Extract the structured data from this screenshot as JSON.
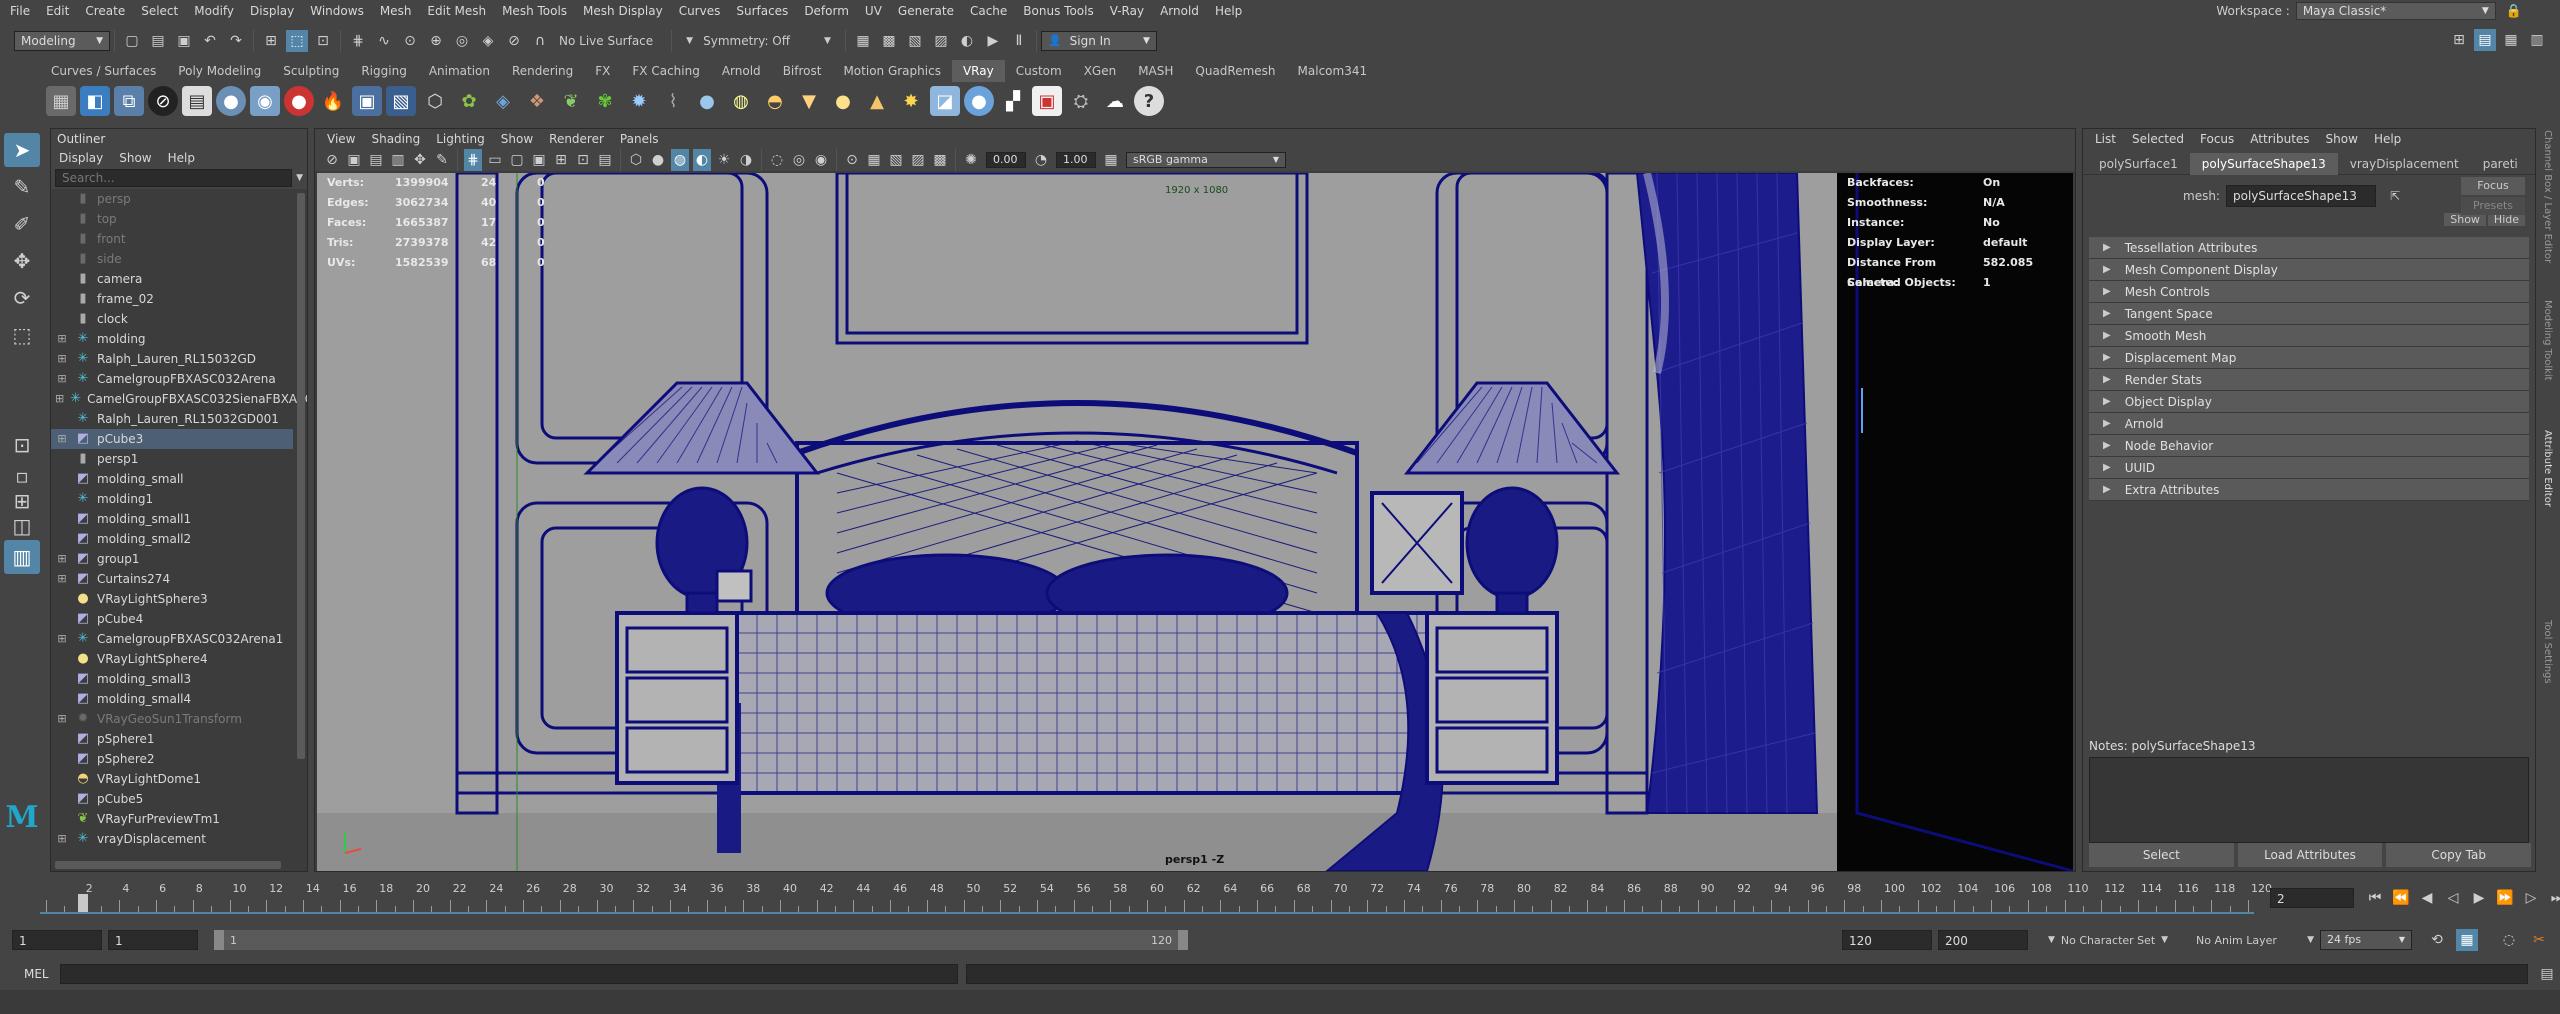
{
  "menu": [
    "File",
    "Edit",
    "Create",
    "Select",
    "Modify",
    "Display",
    "Windows",
    "Mesh",
    "Edit Mesh",
    "Mesh Tools",
    "Mesh Display",
    "Curves",
    "Surfaces",
    "Deform",
    "UV",
    "Generate",
    "Cache",
    "Bonus Tools",
    "V-Ray",
    "Arnold",
    "Help"
  ],
  "workspace": {
    "label": "Workspace :",
    "value": "Maya Classic*"
  },
  "statusline": {
    "mode": "Modeling",
    "live_surface": "No Live Surface",
    "symmetry": "Symmetry: Off",
    "sign_in": "Sign In"
  },
  "shelf_tabs": [
    "Curves / Surfaces",
    "Poly Modeling",
    "Sculpting",
    "Rigging",
    "Animation",
    "Rendering",
    "FX",
    "FX Caching",
    "Arnold",
    "Bifrost",
    "Motion Graphics",
    "VRay",
    "Custom",
    "XGen",
    "MASH",
    "QuadRemesh",
    "Malcom341"
  ],
  "shelf_active": "VRay",
  "outliner": {
    "title": "Outliner",
    "menu": [
      "Display",
      "Show",
      "Help"
    ],
    "search_placeholder": "Search...",
    "items": [
      {
        "name": "persp",
        "icon": "camera",
        "dim": true,
        "expand": false
      },
      {
        "name": "top",
        "icon": "camera",
        "dim": true,
        "expand": false
      },
      {
        "name": "front",
        "icon": "camera",
        "dim": true,
        "expand": false
      },
      {
        "name": "side",
        "icon": "camera",
        "dim": true,
        "expand": false
      },
      {
        "name": "camera",
        "icon": "camera",
        "dim": false,
        "expand": false
      },
      {
        "name": "frame_02",
        "icon": "camera",
        "dim": false,
        "expand": false
      },
      {
        "name": "clock",
        "icon": "camera",
        "dim": false,
        "expand": false
      },
      {
        "name": "molding",
        "icon": "group",
        "dim": false,
        "expand": true
      },
      {
        "name": "Ralph_Lauren_RL15032GD",
        "icon": "group",
        "dim": false,
        "expand": true
      },
      {
        "name": "CamelgroupFBXASC032Arena",
        "icon": "group",
        "dim": false,
        "expand": true
      },
      {
        "name": "CamelGroupFBXASC032SienaFBXASC",
        "icon": "group",
        "dim": false,
        "expand": true
      },
      {
        "name": "Ralph_Lauren_RL15032GD001",
        "icon": "group",
        "dim": false,
        "expand": false
      },
      {
        "name": "pCube3",
        "icon": "mesh",
        "dim": false,
        "expand": true,
        "selected": true
      },
      {
        "name": "persp1",
        "icon": "camera",
        "dim": false,
        "expand": false
      },
      {
        "name": "molding_small",
        "icon": "mesh",
        "dim": false,
        "expand": false
      },
      {
        "name": "molding1",
        "icon": "group",
        "dim": false,
        "expand": false
      },
      {
        "name": "molding_small1",
        "icon": "mesh",
        "dim": false,
        "expand": false
      },
      {
        "name": "molding_small2",
        "icon": "mesh",
        "dim": false,
        "expand": false
      },
      {
        "name": "group1",
        "icon": "mesh",
        "dim": false,
        "expand": true
      },
      {
        "name": "Curtains274",
        "icon": "mesh",
        "dim": false,
        "expand": true
      },
      {
        "name": "VRayLightSphere3",
        "icon": "light",
        "dim": false,
        "expand": false
      },
      {
        "name": "pCube4",
        "icon": "mesh",
        "dim": false,
        "expand": false
      },
      {
        "name": "CamelgroupFBXASC032Arena1",
        "icon": "group",
        "dim": false,
        "expand": true
      },
      {
        "name": "VRayLightSphere4",
        "icon": "light",
        "dim": false,
        "expand": false
      },
      {
        "name": "molding_small3",
        "icon": "mesh",
        "dim": false,
        "expand": false
      },
      {
        "name": "molding_small4",
        "icon": "mesh",
        "dim": false,
        "expand": false
      },
      {
        "name": "VRayGeoSun1Transform",
        "icon": "sun",
        "dim": true,
        "expand": true
      },
      {
        "name": "pSphere1",
        "icon": "mesh",
        "dim": false,
        "expand": false
      },
      {
        "name": "pSphere2",
        "icon": "mesh",
        "dim": false,
        "expand": false
      },
      {
        "name": "VRayLightDome1",
        "icon": "dome",
        "dim": false,
        "expand": false
      },
      {
        "name": "pCube5",
        "icon": "mesh",
        "dim": false,
        "expand": false
      },
      {
        "name": "VRayFurPreviewTm1",
        "icon": "fur",
        "dim": false,
        "expand": false
      },
      {
        "name": "vrayDisplacement",
        "icon": "group",
        "dim": false,
        "expand": true
      }
    ]
  },
  "viewport": {
    "menu": [
      "View",
      "Shading",
      "Lighting",
      "Show",
      "Renderer",
      "Panels"
    ],
    "exposure": "0.00",
    "gamma": "1.00",
    "color_space": "sRGB gamma",
    "resolution": "1920 x 1080",
    "camera_label": "persp1 -Z",
    "hud_left": [
      {
        "label": "Verts:",
        "a": "1399904",
        "b": "24",
        "c": "0"
      },
      {
        "label": "Edges:",
        "a": "3062734",
        "b": "40",
        "c": "0"
      },
      {
        "label": "Faces:",
        "a": "1665387",
        "b": "17",
        "c": "0"
      },
      {
        "label": "Tris:",
        "a": "2739378",
        "b": "42",
        "c": "0"
      },
      {
        "label": "UVs:",
        "a": "1582539",
        "b": "68",
        "c": "0"
      }
    ],
    "hud_right": [
      {
        "label": "Backfaces:",
        "value": "On"
      },
      {
        "label": "Smoothness:",
        "value": "N/A"
      },
      {
        "label": "Instance:",
        "value": "No"
      },
      {
        "label": "Display Layer:",
        "value": "default"
      },
      {
        "label": "Distance From Camera:",
        "value": "582.085"
      },
      {
        "label": "Selected Objects:",
        "value": "1"
      }
    ]
  },
  "attribute_editor": {
    "menu": [
      "List",
      "Selected",
      "Focus",
      "Attributes",
      "Show",
      "Help"
    ],
    "tabs": [
      "polySurface1",
      "polySurfaceShape13",
      "vrayDisplacement",
      "pareti"
    ],
    "active_tab": "polySurfaceShape13",
    "mesh_label": "mesh:",
    "mesh_value": "polySurfaceShape13",
    "focus": "Focus",
    "presets": "Presets",
    "show": "Show",
    "hide": "Hide",
    "sections": [
      "Tessellation Attributes",
      "Mesh Component Display",
      "Mesh Controls",
      "Tangent Space",
      "Smooth Mesh",
      "Displacement Map",
      "Render Stats",
      "Object Display",
      "Arnold",
      "Node Behavior",
      "UUID",
      "Extra Attributes"
    ],
    "notes_label": "Notes:  polySurfaceShape13",
    "buttons": [
      "Select",
      "Load Attributes",
      "Copy Tab"
    ]
  },
  "right_tabs": [
    "Channel Box / Layer Editor",
    "Modeling Toolkit",
    "Attribute Editor",
    "Tool Settings"
  ],
  "timeline": {
    "start": 0,
    "end": 120,
    "step": 2,
    "current": 2,
    "labels": [
      "2",
      "4",
      "6",
      "8",
      "10",
      "12",
      "14",
      "16",
      "18",
      "20",
      "22",
      "24",
      "26",
      "28",
      "30",
      "32",
      "34",
      "36",
      "38",
      "40",
      "42",
      "44",
      "46",
      "48",
      "50",
      "52",
      "54",
      "56",
      "58",
      "60",
      "62",
      "64",
      "66",
      "68",
      "70",
      "72",
      "74",
      "76",
      "78",
      "80",
      "82",
      "84",
      "86",
      "88",
      "90",
      "92",
      "94",
      "96",
      "98",
      "100",
      "102",
      "104",
      "106",
      "108",
      "110",
      "112",
      "114",
      "116",
      "118",
      "120"
    ],
    "current_field": "2"
  },
  "range": {
    "start": "1",
    "playback_start": "1",
    "slider_start": "1",
    "slider_end": "120",
    "playback_end": "120",
    "end": "200",
    "character_set": "No Character Set",
    "anim_layer": "No Anim Layer",
    "fps": "24 fps"
  },
  "command_line": {
    "label": "MEL"
  },
  "colors": {
    "wire": "#0d0d7a",
    "viewport_bg": "#9a9a9a",
    "accent": "#5285a6"
  }
}
